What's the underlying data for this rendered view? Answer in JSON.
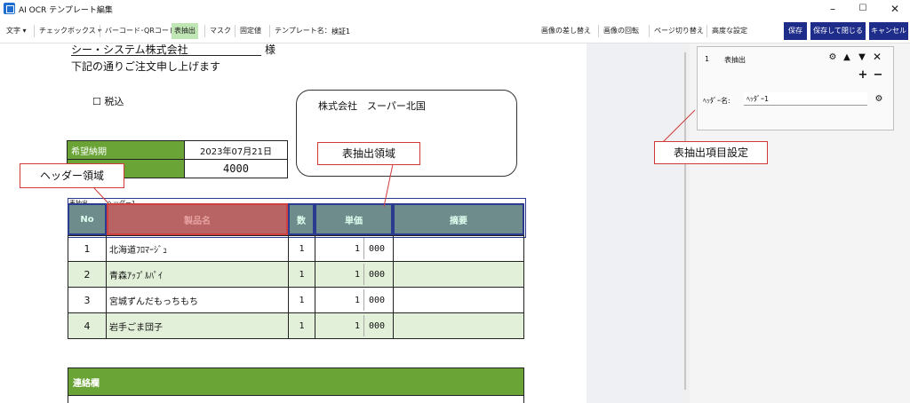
{
  "window": {
    "title": "AI OCR テンプレート編集",
    "controls": {
      "minimize": "–",
      "maximize": "☐",
      "close": "✕"
    }
  },
  "toolbar": {
    "text": "文字 ▾",
    "checkbox": "チェックボックス ▾",
    "barcode": "バーコード･QRコード",
    "table_extract": "表抽出",
    "mask": "マスク",
    "fixed_value": "固定値",
    "template_name_label": "テンプレート名：",
    "template_name_value": "検証1",
    "replace_image": "画像の差し替え",
    "rotate_image": "画像の回転",
    "page_switch": "ページ切り替え",
    "advanced": "高度な設定",
    "save": "保存",
    "save_close": "保存して閉じる",
    "cancel": "キャンセル"
  },
  "document": {
    "company": "シー・システム株式会社",
    "honorific": "様",
    "greeting": "下記の通りご注文申し上げます",
    "tax_checkbox": "☐ 税込",
    "supplier": "株式会社　スーパー北国",
    "delivery_label": "希望納期",
    "delivery_date": "2023年07月21日",
    "total_value": "4000",
    "region_tag": "表抽出",
    "header_tag": "ヘッダー1",
    "table": {
      "headers": [
        "No",
        "製品名",
        "数",
        "単価",
        "摘要"
      ],
      "rows": [
        {
          "no": "1",
          "name": "北海道ﾌﾛﾏｰｼﾞｭ",
          "qty": "1",
          "p1": "1",
          "p2": "000"
        },
        {
          "no": "2",
          "name": "青森ｱｯﾌﾟﾙﾊﾟｲ",
          "qty": "1",
          "p1": "1",
          "p2": "000"
        },
        {
          "no": "3",
          "name": "宮城ずんだもっちもち",
          "qty": "1",
          "p1": "1",
          "p2": "000"
        },
        {
          "no": "4",
          "name": "岩手ごま団子",
          "qty": "1",
          "p1": "1",
          "p2": "000"
        }
      ]
    },
    "contact_label": "連絡欄"
  },
  "annotations": {
    "header_region": "ヘッダー領域",
    "table_region": "表抽出領域",
    "settings": "表抽出項目設定"
  },
  "panel": {
    "item_no": "1",
    "item_name": "表抽出",
    "header_label": "ﾍｯﾀﾞｰ名:",
    "header_value": "ﾍｯﾀﾞｰ1",
    "icons": {
      "gear": "⚙",
      "up": "▲",
      "down": "▼",
      "close": "✕",
      "plus": "+",
      "minus": "−"
    }
  },
  "colors": {
    "green": "#6aa336",
    "light_green": "#e2efd9",
    "blue_selection": "#2b3b8f",
    "red_selection": "#d04040",
    "save_blue": "#1f2d8a"
  }
}
